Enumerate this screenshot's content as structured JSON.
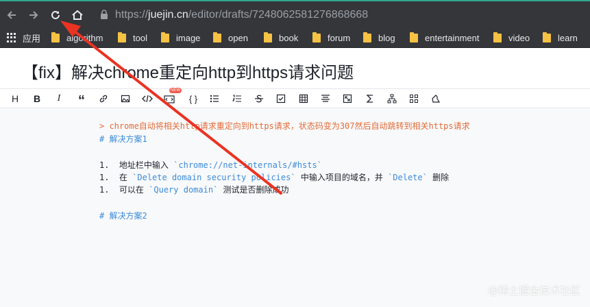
{
  "browser": {
    "url_domain": "juejin.cn",
    "url_scheme": "https://",
    "url_path": "/editor/drafts/7248062581276868668"
  },
  "bookmarks": [
    {
      "label": "应用",
      "icon": "apps-icon"
    },
    {
      "label": "algorithm",
      "icon": "folder-icon"
    },
    {
      "label": "tool",
      "icon": "folder-icon"
    },
    {
      "label": "image",
      "icon": "folder-icon"
    },
    {
      "label": "open",
      "icon": "folder-icon"
    },
    {
      "label": "book",
      "icon": "folder-icon"
    },
    {
      "label": "forum",
      "icon": "folder-icon"
    },
    {
      "label": "blog",
      "icon": "folder-icon"
    },
    {
      "label": "entertainment",
      "icon": "folder-icon"
    },
    {
      "label": "video",
      "icon": "folder-icon"
    },
    {
      "label": "learn",
      "icon": "folder-icon"
    }
  ],
  "doc": {
    "title": "【fix】解决chrome重定向http到https请求问题"
  },
  "toolbar": {
    "heading": "H",
    "bold": "B",
    "italic": "I",
    "quote": "“",
    "brackets": "{ }",
    "new_badge": "NEW"
  },
  "editor": {
    "line1": "> chrome自动将相关http请求重定向到https请求，状态码变为307然后自动跳转到相关https请求",
    "line2": "# 解决方案1",
    "item1_num": "1.",
    "item1_text": "地址栏中输入",
    "item1_code": "`chrome://net-internals/#hsts`",
    "item2_num": "1.",
    "item2_pre": "在",
    "item2_code": "`Delete domain security policies`",
    "item2_mid": "中输入项目的域名，并",
    "item2_code2": "`Delete`",
    "item2_post": "删除",
    "item3_num": "1.",
    "item3_pre": "可以在",
    "item3_code": "`Query domain`",
    "item3_post": "测试是否删除成功",
    "line_h2": "# 解决方案2"
  },
  "watermark": "@稀土掘金技术社区",
  "colors": {
    "browser_bg": "#35363a",
    "accent_tab": "#2fa88e",
    "folder": "#f6c244",
    "quote": "#e06c39",
    "heading": "#3c8bd8",
    "arrow": "#ea3323"
  }
}
